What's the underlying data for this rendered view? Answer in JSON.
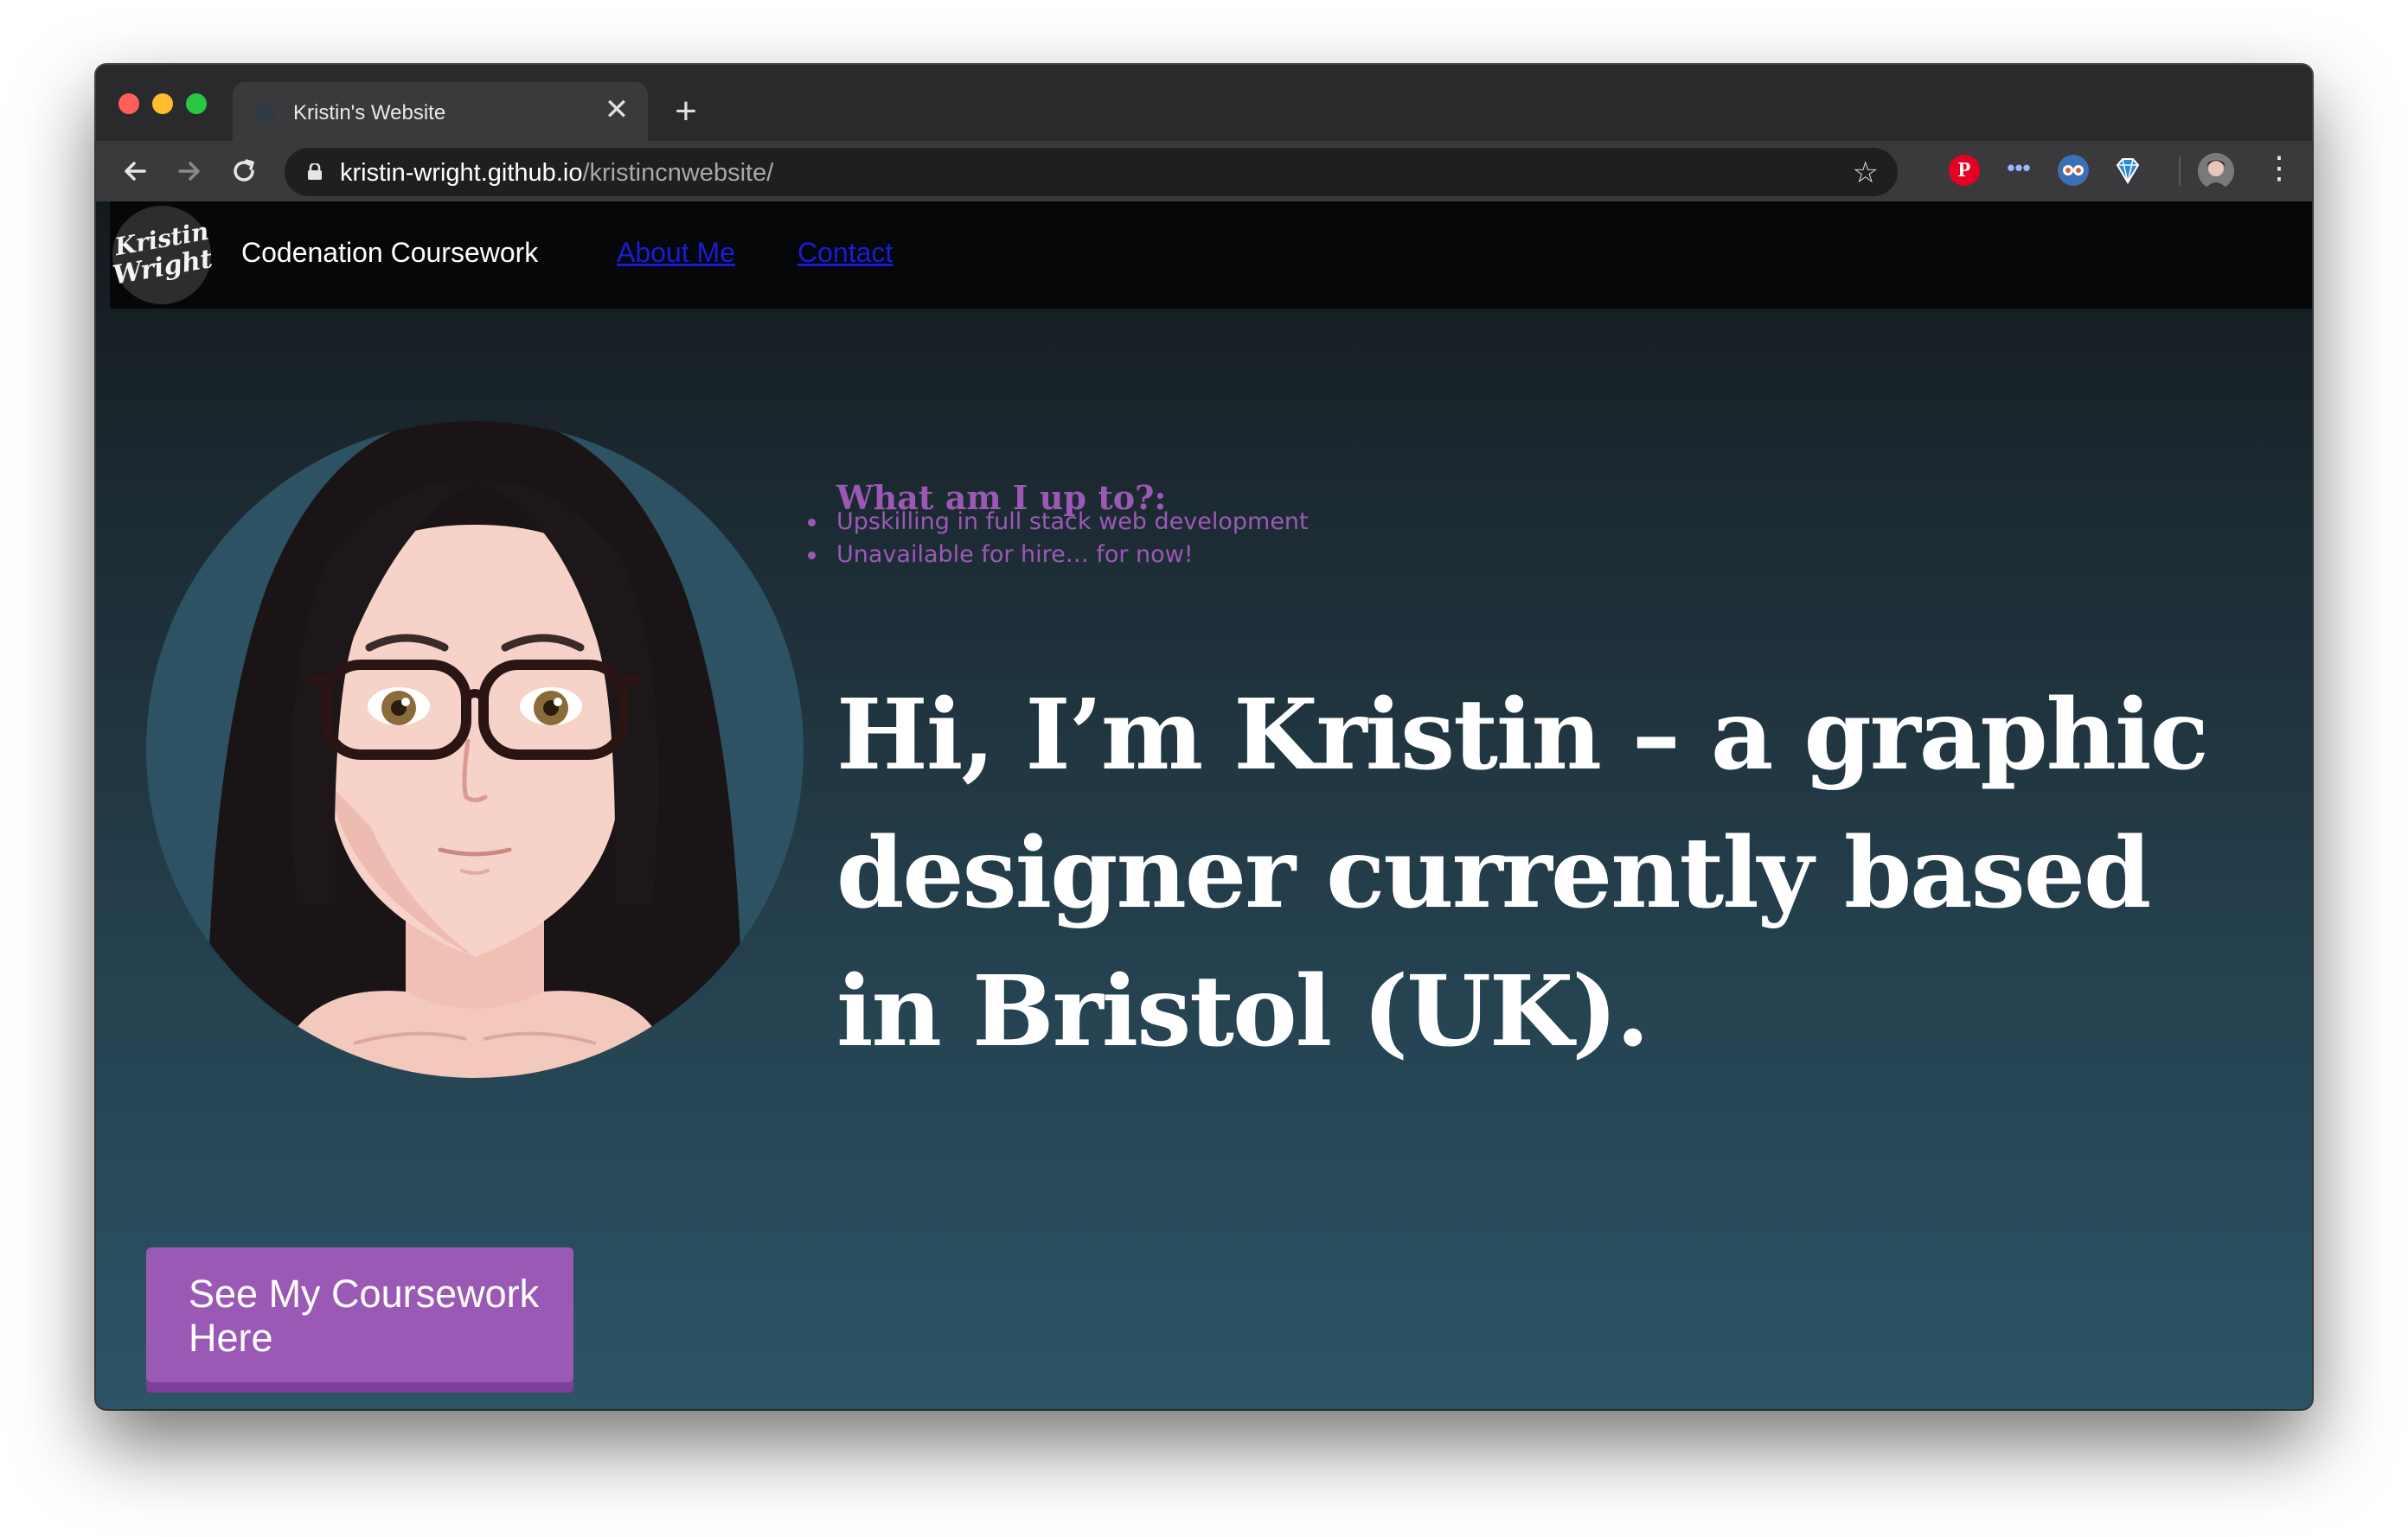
{
  "browser": {
    "tab_title": "Kristin's Website",
    "tab_close": "✕",
    "new_tab": "+",
    "url_host": "kristin-wright.github.io",
    "url_path": "/kristincnwebsite/",
    "icons": [
      "back-arrow-icon",
      "forward-arrow-icon",
      "reload-icon",
      "lock-icon",
      "bookmark-star-icon",
      "pinterest-icon",
      "password-dots-icon",
      "eyes-extension-icon",
      "gem-extension-icon",
      "profile-avatar-icon",
      "menu-kebab-icon"
    ]
  },
  "site": {
    "logo_line1": "Kristin",
    "logo_line2": "Wright",
    "title": "Codenation Coursework",
    "nav": [
      {
        "label": "About Me"
      },
      {
        "label": "Contact"
      }
    ],
    "side_heading": "What am I up to?:",
    "side_items": [
      "Upskilling in full stack web development",
      "Unavailable for hire… for now!"
    ],
    "hero_text": "Hi, I’m Kristin – a graphic designer currently based in Bristol (UK).",
    "cta_label": "See My Coursework Here"
  },
  "colors": {
    "accent_purple": "#9b59b6",
    "link_blue": "#1b1bd6",
    "nav_bg": "#050708",
    "page_gradient_top": "#14191d",
    "page_gradient_bottom": "#2b5466"
  }
}
